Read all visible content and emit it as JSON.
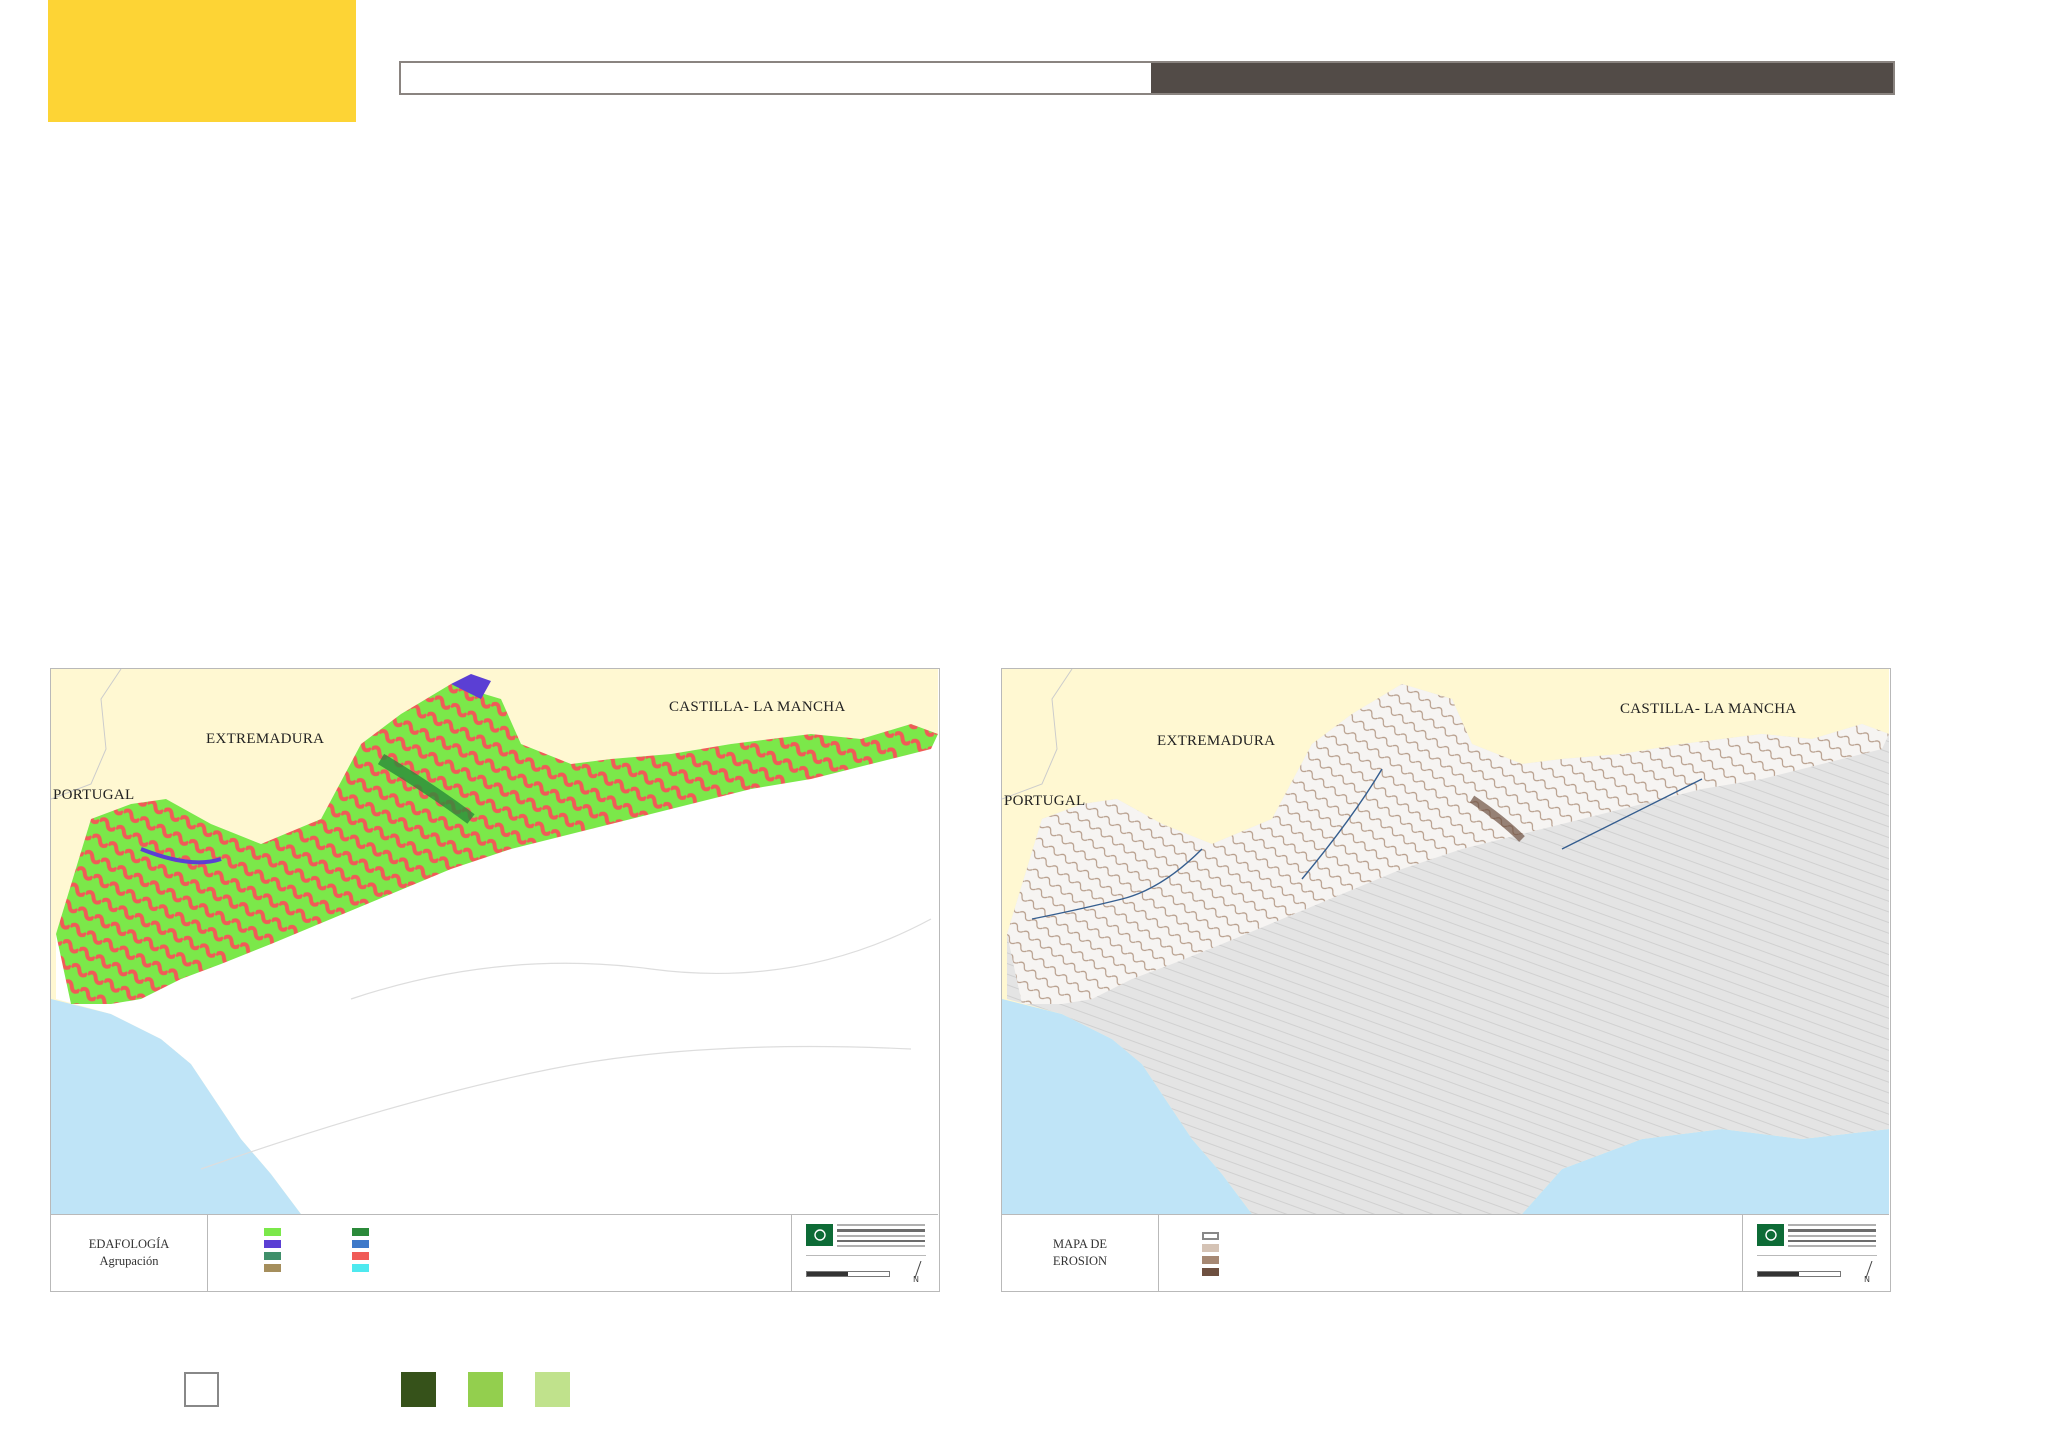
{
  "maps": [
    {
      "regions": {
        "portugal": "PORTUGAL",
        "extremadura": "EXTREMADURA",
        "castilla": "CASTILLA- LA MANCHA"
      },
      "footer": {
        "title_line1": "EDAFOLOGÍA",
        "title_line2": "Agrupación"
      },
      "legend": [
        {
          "color": "#7be84a"
        },
        {
          "color": "#2b8a3a"
        },
        {
          "color": "#5b3fd4"
        },
        {
          "color": "#3e79c9"
        },
        {
          "color": "#3f8f6a"
        },
        {
          "color": "#f05b57"
        },
        {
          "color": "#a58e5c"
        },
        {
          "color": "#4ee9ef"
        }
      ]
    },
    {
      "regions": {
        "portugal": "PORTUGAL",
        "extremadura": "EXTREMADURA",
        "castilla": "CASTILLA- LA MANCHA"
      },
      "footer": {
        "title_line1": "MAPA DE",
        "title_line2": "EROSION"
      },
      "legend": [
        {
          "color": "#ffffff"
        },
        {
          "color": "#d5c3b5"
        },
        {
          "color": "#a68873"
        },
        {
          "color": "#6e5040"
        }
      ]
    }
  ],
  "bottom_legend": [
    {
      "color": "#ffffff"
    },
    {
      "color": "#36521a"
    },
    {
      "color": "#93cf4e"
    },
    {
      "color": "#c0e28c"
    }
  ],
  "colors": {
    "accent_yellow": "#fdd435",
    "header_dark": "#524b47",
    "sea": "#bfe4f7",
    "neighbor_land": "#fff8d2"
  }
}
